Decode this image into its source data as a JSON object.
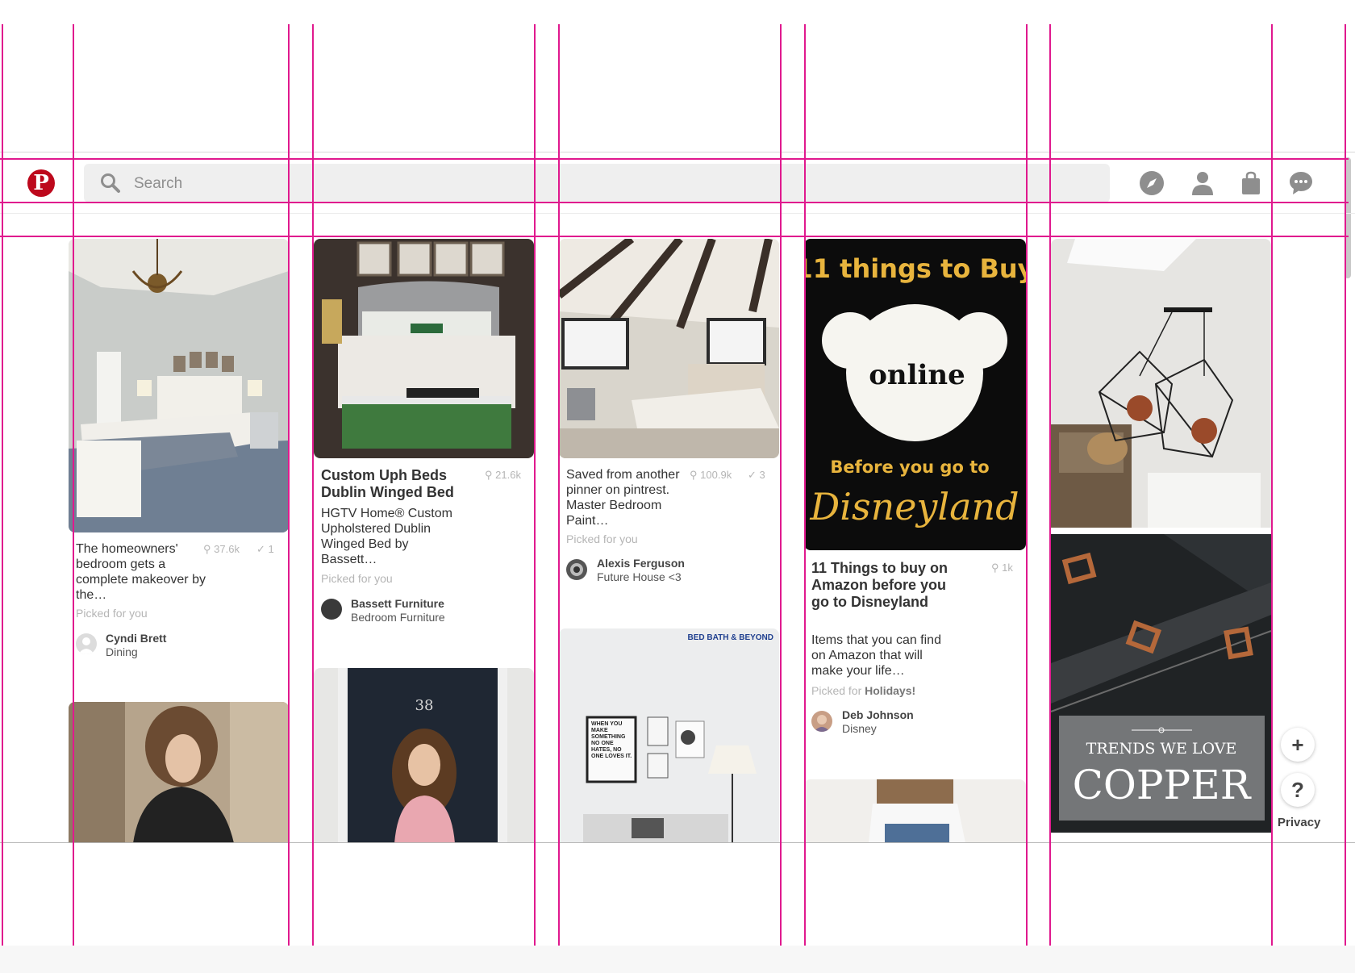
{
  "app": {
    "logo_letter": "P",
    "brand_color": "#bd081c",
    "guide_color": "#e0198e"
  },
  "search": {
    "placeholder": "Search"
  },
  "header_icons": [
    "compass-icon",
    "profile-icon",
    "shopping-bag-icon",
    "messages-icon"
  ],
  "pins": [
    {
      "title": "",
      "description": "The homeowners' bedroom gets a complete makeover by the…",
      "saves": "37.6k",
      "tried": "1",
      "picked": "Picked for you",
      "picked_bold": "",
      "user": "Cyndi Brett",
      "board": "Dining"
    },
    {
      "title": "Custom Uph Beds Dublin Winged Bed",
      "description": "HGTV Home® Custom Upholstered Dublin Winged Bed by Bassett…",
      "saves": "21.6k",
      "tried": "",
      "picked": "Picked for you",
      "picked_bold": "",
      "user": "Bassett Furniture",
      "board": "Bedroom Furniture"
    },
    {
      "title": "",
      "description": "Saved from another pinner on pintrest. Master Bedroom Paint…",
      "saves": "100.9k",
      "tried": "3",
      "picked": "Picked for you",
      "picked_bold": "",
      "user": "Alexis Ferguson",
      "board": "Future House <3"
    },
    {
      "title": "11 Things to buy on Amazon before you go to Disneyland",
      "description": "Items that you can find on Amazon that will make your life…",
      "saves": "1k",
      "tried": "",
      "picked": "Picked for ",
      "picked_bold": "Holidays!",
      "user": "Deb Johnson",
      "board": "Disney"
    }
  ],
  "disney_image": {
    "line1": "11 things to Buy",
    "line2": "online",
    "line3": "Before you go to",
    "line4": "Disneyland"
  },
  "door_number": "38",
  "bbb_logo": "BED BATH & BEYOND",
  "poster_text": "WHEN YOU MAKE SOMETHING NO ONE HATES, NO ONE LOVES IT.",
  "copper_image": {
    "line1": "TRENDS WE LOVE",
    "line2": "COPPER"
  },
  "floating": {
    "add": "+",
    "help": "?",
    "privacy": "Privacy"
  }
}
